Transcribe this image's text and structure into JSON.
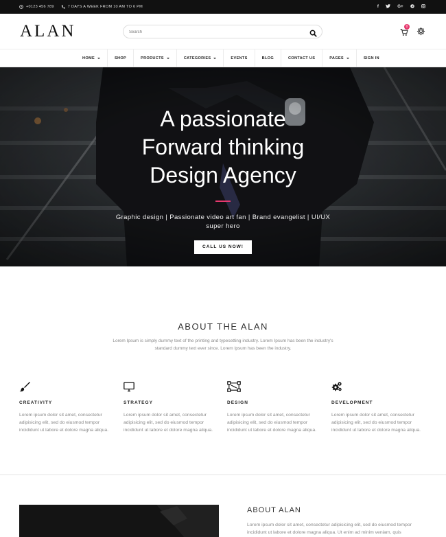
{
  "topbar": {
    "phone": "+0123 456 789",
    "hours": "7 DAYS A WEEK FROM 10 AM TO 6 PM",
    "social": [
      "f",
      "t",
      "G+",
      "p",
      "ig"
    ]
  },
  "header": {
    "logo": "ALAN",
    "search_placeholder": "Search",
    "cart_count": "0"
  },
  "nav": {
    "items": [
      {
        "label": "HOME",
        "dropdown": true
      },
      {
        "label": "SHOP",
        "dropdown": false
      },
      {
        "label": "PRODUCTS",
        "dropdown": true
      },
      {
        "label": "CATEGORIES",
        "dropdown": true
      },
      {
        "label": "EVENTS",
        "dropdown": false
      },
      {
        "label": "BLOG",
        "dropdown": false
      },
      {
        "label": "CONTACT US",
        "dropdown": false
      },
      {
        "label": "PAGES",
        "dropdown": true
      },
      {
        "label": "SIGN IN",
        "dropdown": false
      }
    ]
  },
  "hero": {
    "title_line1": "A passionate",
    "title_line2": "Forward thinking",
    "title_line3": "Design Agency",
    "subtitle": "Graphic design | Passionate video art fan | Brand evangelist | UI/UX super hero",
    "cta": "CALL US NOW!",
    "accent_color": "#e6396e"
  },
  "about": {
    "title": "ABOUT THE ALAN",
    "description": "Lorem Ipsum is simply dummy text of the printing and typesetting industry. Lorem Ipsum has been the industry's standard dummy text ever since. Lorem Ipsum has been the industry.",
    "features": [
      {
        "icon": "paintbrush-icon",
        "name": "CREATIVITY",
        "text": "Lorem ipsum dolor sit amet, consectetur adipisicing elit, sed do eiusmod tempor incididunt ut labore et dolore magna aliqua."
      },
      {
        "icon": "monitor-icon",
        "name": "STRATEGY",
        "text": "Lorem ipsum dolor sit amet, consectetur adipisicing elit, sed do eiusmod tempor incididunt ut labore et dolore magna aliqua."
      },
      {
        "icon": "vector-design-icon",
        "name": "DESIGN",
        "text": "Lorem ipsum dolor sit amet, consectetur adipisicing elit, sed do eiusmod tempor incididunt ut labore et dolore magna aliqua."
      },
      {
        "icon": "gears-icon",
        "name": "DEVELOPMENT",
        "text": "Lorem ipsum dolor sit amet, consectetur adipisicing elit, sed do eiusmod tempor incididunt ut labore et dolore magna aliqua."
      }
    ]
  },
  "about2": {
    "title": "ABOUT ALAN",
    "text": "Lorem ipsum dolor sit amet, consectetur adipisicing elit, sed do eiusmod tempor incididunt ut labore et dolore magna aliqua. Ut enim ad minim veniam, quis"
  }
}
